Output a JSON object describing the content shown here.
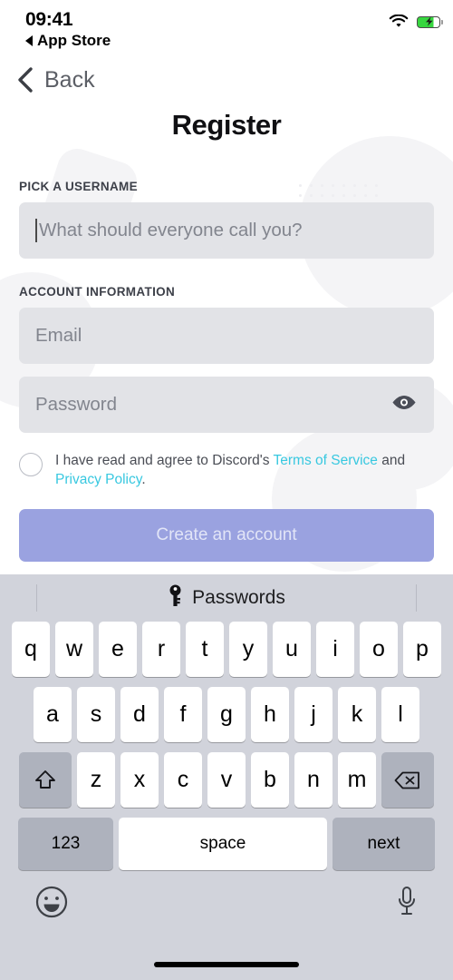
{
  "status_bar": {
    "time": "09:41",
    "return_app": "App Store",
    "wifi_icon": "wifi-icon",
    "battery_icon": "battery-charging-icon"
  },
  "nav": {
    "back_label": "Back",
    "back_icon": "chevron-left-icon"
  },
  "page": {
    "title": "Register"
  },
  "username_section": {
    "label": "PICK A USERNAME",
    "placeholder": "What should everyone call you?",
    "value": ""
  },
  "account_section": {
    "label": "ACCOUNT INFORMATION",
    "email_placeholder": "Email",
    "email_value": "",
    "password_placeholder": "Password",
    "password_value": "",
    "reveal_icon": "eye-icon"
  },
  "agreement": {
    "checked": false,
    "text_before": "I have read and agree to Discord's ",
    "link_tos": "Terms of Service",
    "text_middle": " and ",
    "link_privacy": "Privacy Policy",
    "text_after": "."
  },
  "submit": {
    "label": "Create an account",
    "enabled": false,
    "color": "#9aa2e0"
  },
  "colors": {
    "link": "#38c8e0",
    "field_bg": "#e2e3e7",
    "keyboard_bg": "#d1d3db"
  },
  "keyboard": {
    "suggestion_label": "Passwords",
    "suggestion_icon": "key-icon",
    "row1": [
      "q",
      "w",
      "e",
      "r",
      "t",
      "y",
      "u",
      "i",
      "o",
      "p"
    ],
    "row2": [
      "a",
      "s",
      "d",
      "f",
      "g",
      "h",
      "j",
      "k",
      "l"
    ],
    "row3": [
      "z",
      "x",
      "c",
      "v",
      "b",
      "n",
      "m"
    ],
    "shift_icon": "shift-icon",
    "backspace_icon": "backspace-icon",
    "numeric_label": "123",
    "space_label": "space",
    "return_label": "next",
    "emoji_icon": "emoji-icon",
    "dictation_icon": "microphone-icon"
  }
}
